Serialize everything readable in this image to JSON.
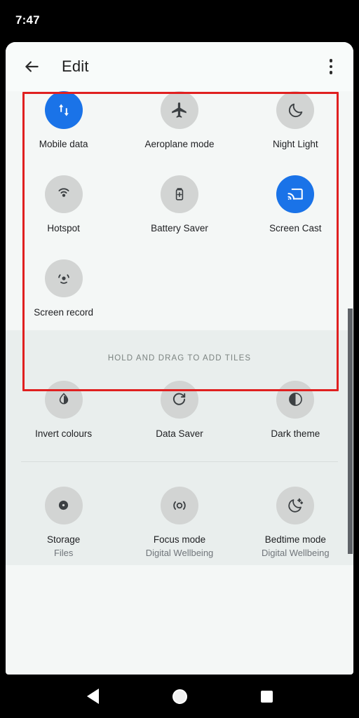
{
  "status_bar": {
    "clock": "7:47"
  },
  "header": {
    "back_icon": "back-arrow-icon",
    "title": "Edit",
    "overflow_icon": "more-vert-icon"
  },
  "colors": {
    "accent_active_tile": "#1a73e8",
    "annotation_box": "#e02020",
    "card_background": "#f4f7f6",
    "available_section_background": "#e9eeed",
    "tile_circle": "#d2d4d3",
    "label_text": "#202124",
    "sub_text": "#70757a",
    "hint_text": "#7b8380",
    "scrollbar_thumb": "#5f6368"
  },
  "active_tiles": {
    "rows": [
      [
        {
          "label": "Mobile data",
          "icon": "mobile-data-icon",
          "active": true
        },
        {
          "label": "Aeroplane mode",
          "icon": "airplane-icon",
          "active": false
        },
        {
          "label": "Night Light",
          "icon": "moon-icon",
          "active": false
        }
      ],
      [
        {
          "label": "Hotspot",
          "icon": "hotspot-icon",
          "active": false
        },
        {
          "label": "Battery Saver",
          "icon": "battery-saver-icon",
          "active": false
        },
        {
          "label": "Screen Cast",
          "icon": "cast-icon",
          "active": true
        }
      ],
      [
        {
          "label": "Screen record",
          "icon": "screen-record-icon",
          "active": false
        }
      ]
    ]
  },
  "available_section": {
    "hint": "HOLD AND DRAG TO ADD TILES",
    "rows": [
      [
        {
          "label": "Invert colours",
          "sub": "",
          "icon": "invert-colours-icon"
        },
        {
          "label": "Data Saver",
          "sub": "",
          "icon": "data-saver-icon"
        },
        {
          "label": "Dark theme",
          "sub": "",
          "icon": "dark-theme-icon"
        }
      ],
      [
        {
          "label": "Storage",
          "sub": "Files",
          "icon": "storage-icon"
        },
        {
          "label": "Focus mode",
          "sub": "Digital Wellbeing",
          "icon": "focus-mode-icon"
        },
        {
          "label": "Bedtime mode",
          "sub": "Digital Wellbeing",
          "icon": "bedtime-mode-icon"
        }
      ]
    ]
  },
  "navigation_bar": {
    "back": "nav-back-icon",
    "home": "nav-home-icon",
    "recents": "nav-recents-icon"
  }
}
